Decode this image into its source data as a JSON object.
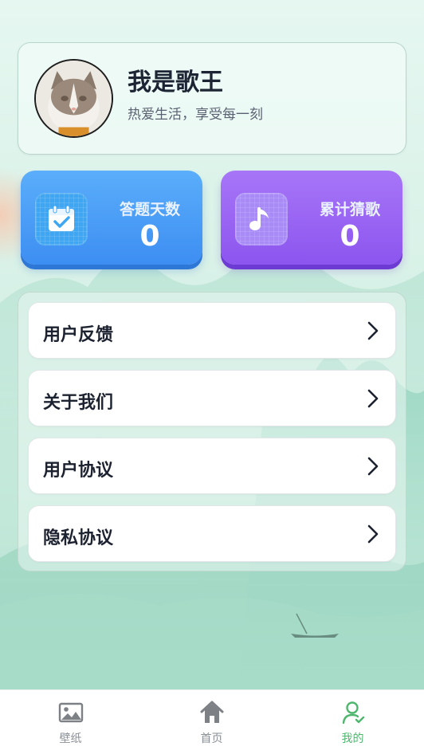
{
  "profile": {
    "name": "我是歌王",
    "motto": "热爱生活，享受每一刻"
  },
  "stats": {
    "answer_days": {
      "label": "答题天数",
      "value": "0",
      "icon": "calendar-check-icon"
    },
    "total_songs": {
      "label": "累计猜歌",
      "value": "0",
      "icon": "music-note-icon"
    }
  },
  "menu": {
    "items": [
      {
        "label": "用户反馈"
      },
      {
        "label": "关于我们"
      },
      {
        "label": "用户协议"
      },
      {
        "label": "隐私协议"
      }
    ]
  },
  "tabbar": {
    "tabs": [
      {
        "label": "壁纸",
        "icon": "image-icon"
      },
      {
        "label": "首页",
        "icon": "home-icon"
      },
      {
        "label": "我的",
        "icon": "user-icon",
        "active": true
      }
    ]
  },
  "colors": {
    "accent_green": "#4fb66e",
    "blue_card": "#3d8ef2",
    "purple_card": "#8c55ef"
  }
}
